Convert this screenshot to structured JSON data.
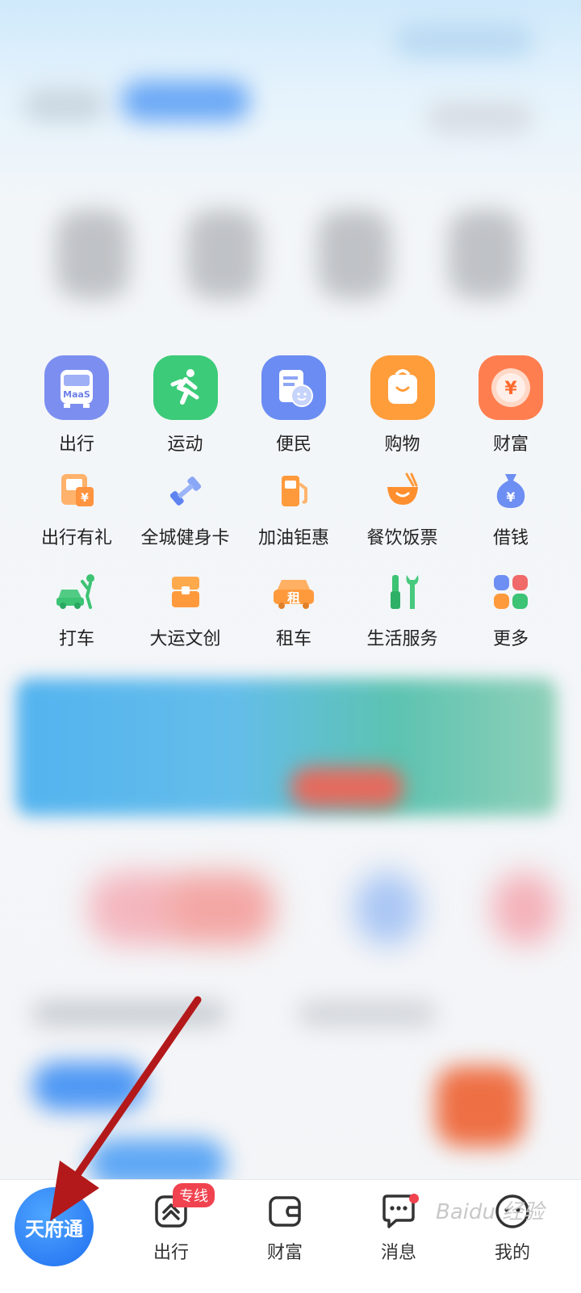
{
  "grid": {
    "row1": [
      {
        "label": "出行",
        "icon": "bus-maas-icon",
        "badge_text": "MaaS",
        "color": "#7c8ff0"
      },
      {
        "label": "运动",
        "icon": "running-man-icon",
        "color": "#3ccb78"
      },
      {
        "label": "便民",
        "icon": "document-smile-icon",
        "color": "#6b8cf2"
      },
      {
        "label": "购物",
        "icon": "shopping-bag-icon",
        "color": "#ff9d3b"
      },
      {
        "label": "财富",
        "icon": "coin-yen-icon",
        "symbol": "¥",
        "color": "#ff7e4f"
      }
    ],
    "row2": [
      {
        "label": "出行有礼",
        "icon": "gift-card-icon"
      },
      {
        "label": "全城健身卡",
        "icon": "dumbbell-icon"
      },
      {
        "label": "加油钜惠",
        "icon": "fuel-pump-icon"
      },
      {
        "label": "餐饮饭票",
        "icon": "bowl-chopsticks-icon"
      },
      {
        "label": "借钱",
        "icon": "money-bag-icon",
        "symbol": "¥"
      }
    ],
    "row3": [
      {
        "label": "打车",
        "icon": "taxi-hail-icon"
      },
      {
        "label": "大运文创",
        "icon": "gift-box-icon"
      },
      {
        "label": "租车",
        "icon": "rent-car-icon",
        "symbol": "租"
      },
      {
        "label": "生活服务",
        "icon": "tools-icon"
      },
      {
        "label": "更多",
        "icon": "grid-more-icon"
      }
    ]
  },
  "tabbar": {
    "home_label": "天府通",
    "tabs": [
      {
        "label": "出行",
        "icon": "travel-icon",
        "badge": "专线"
      },
      {
        "label": "财富",
        "icon": "wallet-icon"
      },
      {
        "label": "消息",
        "icon": "chat-icon"
      },
      {
        "label": "我的",
        "icon": "profile-smile-icon"
      }
    ]
  },
  "watermark": "Baidu 经验",
  "colors": {
    "primary": "#1f6ef0",
    "badge": "#f0434f",
    "annotation": "#b3191a"
  }
}
